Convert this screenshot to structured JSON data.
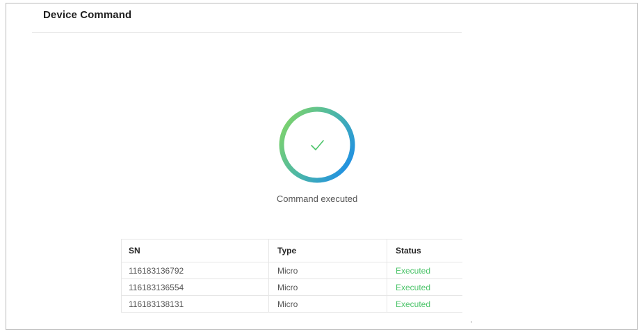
{
  "page": {
    "title": "Device Command"
  },
  "result": {
    "icon": "check-icon",
    "message": "Command executed",
    "colors": {
      "ring_start": "#7ed36b",
      "ring_end": "#1e8ee6",
      "check": "#4cc46a"
    }
  },
  "table": {
    "columns": [
      "SN",
      "Type",
      "Status"
    ],
    "rows": [
      {
        "sn": "116183136792",
        "type": "Micro",
        "status": "Executed"
      },
      {
        "sn": "116183136554",
        "type": "Micro",
        "status": "Executed"
      },
      {
        "sn": "116183138131",
        "type": "Micro",
        "status": "Executed"
      }
    ],
    "status_color": "#4cc46a"
  }
}
